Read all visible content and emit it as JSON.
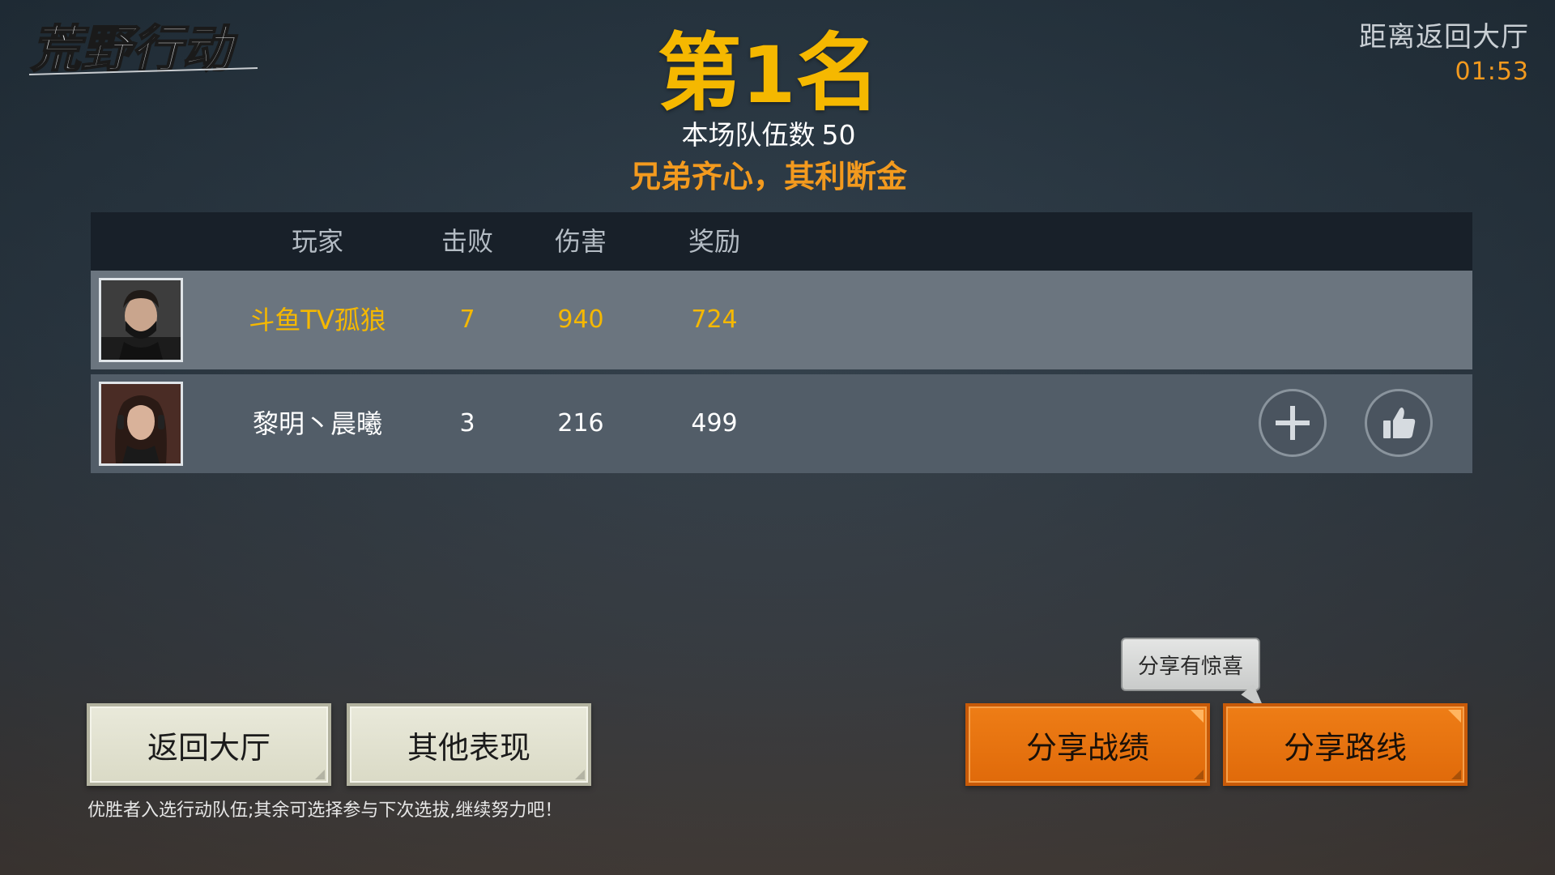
{
  "logo": {
    "text": "荒野行动"
  },
  "countdown": {
    "label": "距离返回大厅",
    "time": "01:53"
  },
  "header": {
    "rank_prefix": "第",
    "rank_number": "1",
    "rank_suffix": "名",
    "team_count_label": "本场队伍数",
    "team_count_value": "50",
    "motto": "兄弟齐心，其利断金"
  },
  "table": {
    "columns": {
      "player": "玩家",
      "kills": "击败",
      "damage": "伤害",
      "reward": "奖励"
    },
    "rows": [
      {
        "name": "斗鱼TV孤狼",
        "kills": "7",
        "damage": "940",
        "reward": "724",
        "highlight": true
      },
      {
        "name": "黎明丶晨曦",
        "kills": "3",
        "damage": "216",
        "reward": "499",
        "highlight": false
      }
    ]
  },
  "buttons": {
    "back_to_lobby": "返回大厅",
    "other_performance": "其他表现",
    "share_record": "分享战绩",
    "share_route": "分享路线"
  },
  "tooltip": {
    "text": "分享有惊喜"
  },
  "hint": {
    "text": "优胜者入选行动队伍;其余可选择参与下次选拔,继续努力吧！"
  },
  "icons": {
    "add_friend": "plus-icon",
    "like": "thumbs-up-icon"
  },
  "colors": {
    "rank_gold": "#f5b800",
    "accent_orange": "#f39a1e",
    "share_button": "#ee7d16"
  }
}
